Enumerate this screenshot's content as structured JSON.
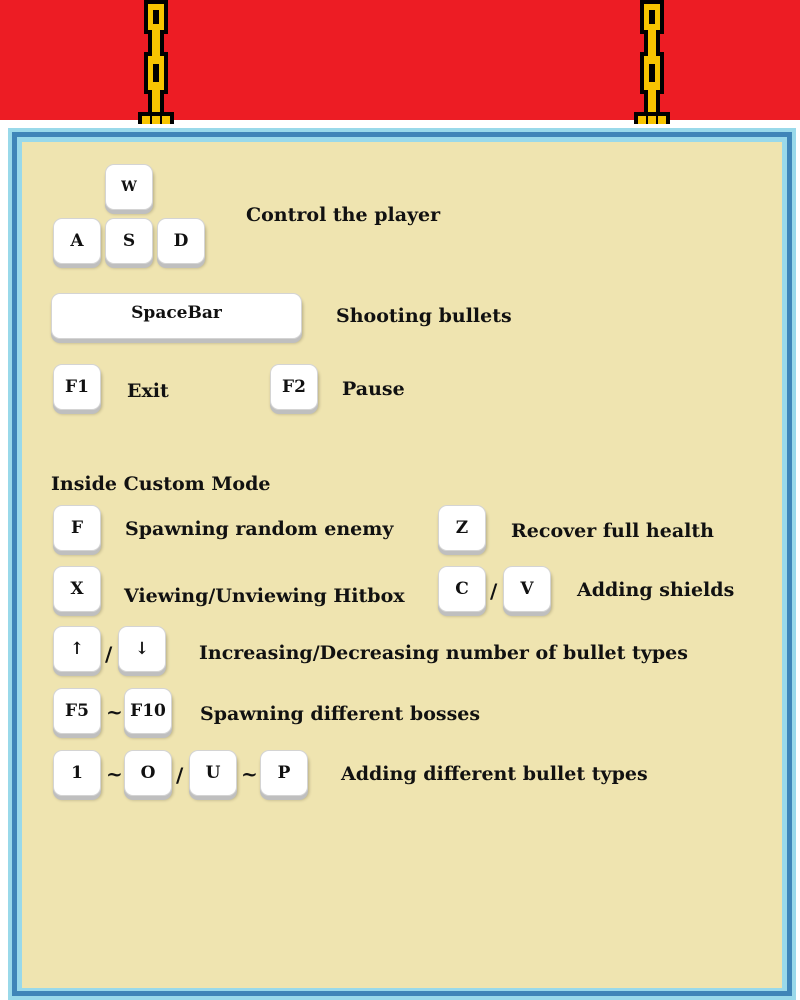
{
  "colors": {
    "band": "#ed1c24",
    "board": "#efe4b0",
    "frame_dark": "#3f85b8",
    "frame_light": "#99d9ea",
    "chain": "#f7c400"
  },
  "movement": {
    "keys": [
      "W",
      "A",
      "S",
      "D"
    ],
    "label": "Control the player"
  },
  "shoot": {
    "key": "SpaceBar",
    "label": "Shooting bullets"
  },
  "exit": {
    "key": "F1",
    "label": "Exit"
  },
  "pause": {
    "key": "F2",
    "label": "Pause"
  },
  "custom_mode": {
    "heading": "Inside Custom Mode",
    "spawn_enemy": {
      "key": "F",
      "label": "Spawning random enemy"
    },
    "recover": {
      "key": "Z",
      "label": "Recover full health"
    },
    "hitbox": {
      "key": "X",
      "label": "Viewing/Unviewing Hitbox"
    },
    "shields": {
      "keys": [
        "C",
        "V"
      ],
      "sep": "/",
      "label": "Adding shields"
    },
    "bullet_count": {
      "keys": [
        "↑",
        "↓"
      ],
      "sep": "/",
      "label": "Increasing/Decreasing number of bullet types"
    },
    "bosses": {
      "keys": [
        "F5",
        "F10"
      ],
      "sep": "~",
      "label": "Spawning different bosses"
    },
    "bullet_types": {
      "keys": [
        "1",
        "O",
        "U",
        "P"
      ],
      "seps": [
        "~",
        "/",
        "~"
      ],
      "label": "Adding different bullet types"
    }
  }
}
